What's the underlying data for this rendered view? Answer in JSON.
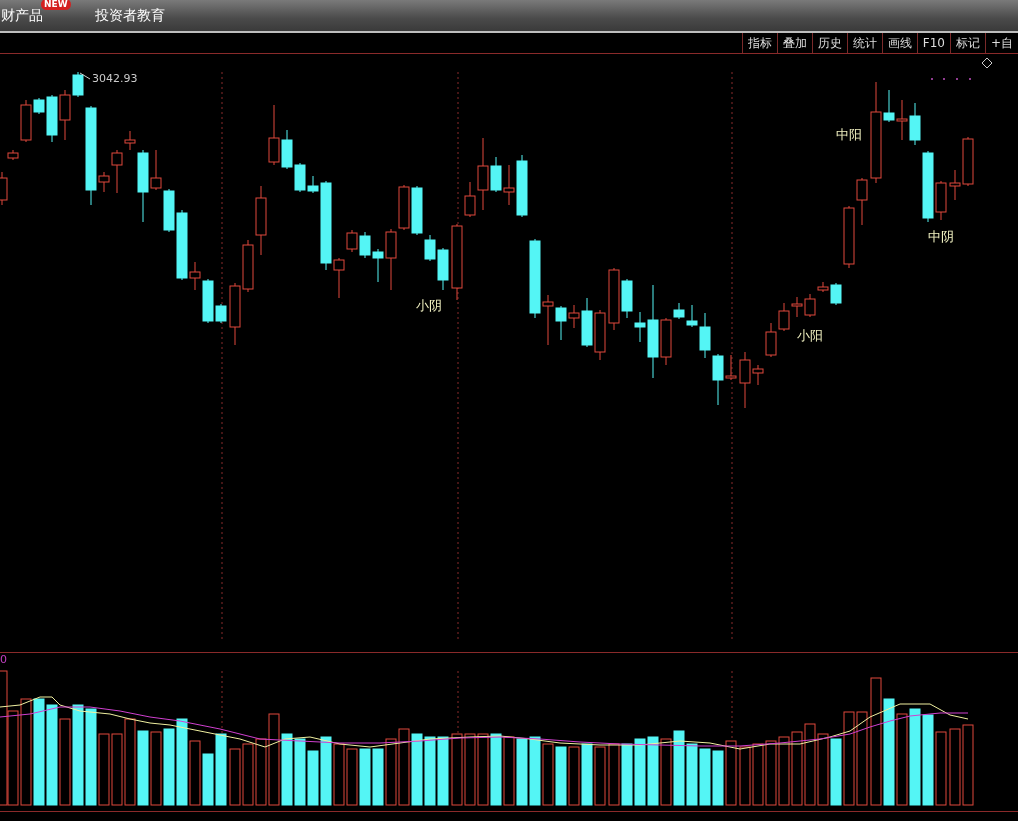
{
  "top_menu": [
    {
      "label": "财产品",
      "badge": "NEW"
    },
    {
      "label": "投资者教育"
    }
  ],
  "toolbar": {
    "buttons": [
      "指标",
      "叠加",
      "历史",
      "统计",
      "画线",
      "F10",
      "标记",
      "+自"
    ]
  },
  "price_chart": {
    "high_label": "3042.93",
    "annotations": [
      {
        "text": "小阴"
      },
      {
        "text": "小阳"
      },
      {
        "text": "中阳"
      },
      {
        "text": "中阴"
      }
    ]
  },
  "volume_chart": {
    "axis_label": "0"
  }
}
